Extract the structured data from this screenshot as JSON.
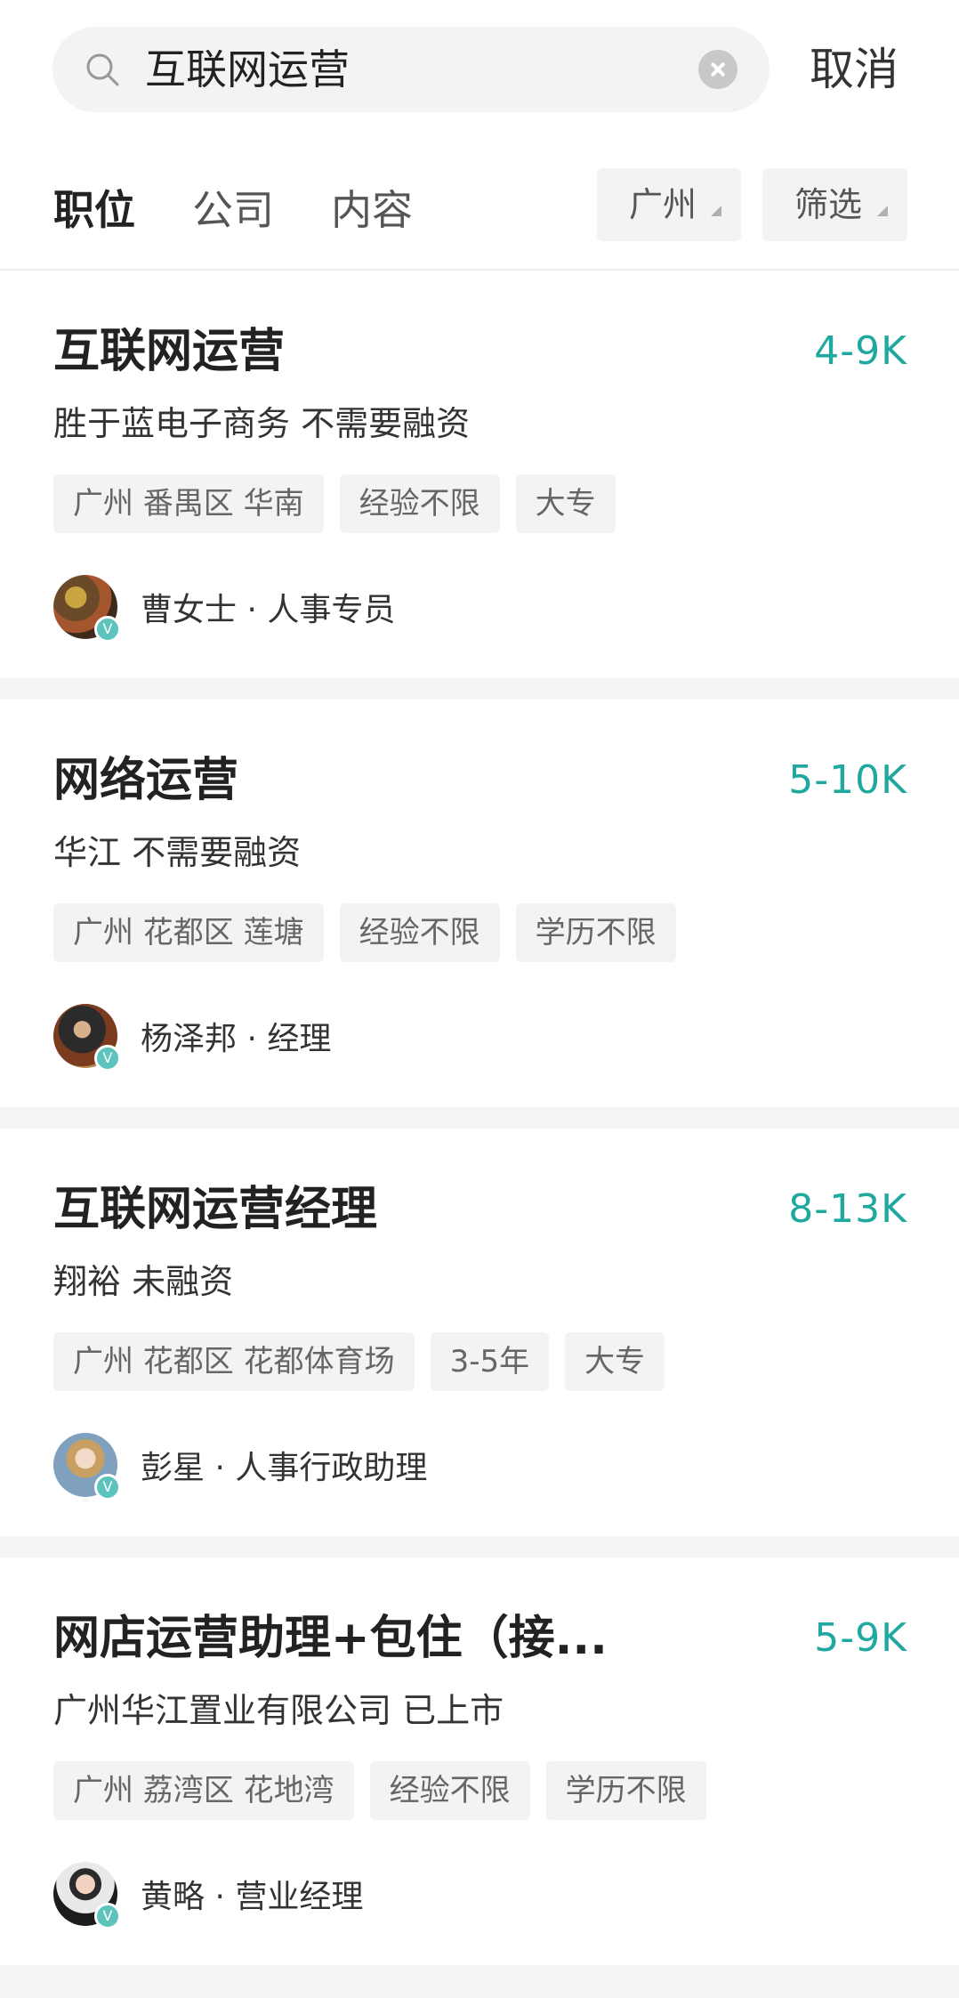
{
  "search": {
    "query": "互联网运营",
    "cancel_label": "取消"
  },
  "tabs": [
    {
      "label": "职位",
      "active": true
    },
    {
      "label": "公司",
      "active": false
    },
    {
      "label": "内容",
      "active": false
    }
  ],
  "filters": {
    "city_label": "广州",
    "more_label": "筛选"
  },
  "colors": {
    "salary": "#1fa8a0",
    "badge": "#5cc4bd"
  },
  "jobs": [
    {
      "title": "互联网运营",
      "salary": "4-9K",
      "company": "胜于蓝电子商务  不需要融资",
      "tags": [
        "广州 番禺区 华南",
        "经验不限",
        "大专"
      ],
      "recruiter": "曹女士 · 人事专员",
      "badge": "V"
    },
    {
      "title": "网络运营",
      "salary": "5-10K",
      "company": "华江  不需要融资",
      "tags": [
        "广州 花都区 莲塘",
        "经验不限",
        "学历不限"
      ],
      "recruiter": "杨泽邦 · 经理",
      "badge": "V"
    },
    {
      "title": "互联网运营经理",
      "salary": "8-13K",
      "company": "翔裕  未融资",
      "tags": [
        "广州 花都区 花都体育场",
        "3-5年",
        "大专"
      ],
      "recruiter": "彭星 · 人事行政助理",
      "badge": "V"
    },
    {
      "title": "网店运营助理+包住（接...",
      "salary": "5-9K",
      "company": "广州华江置业有限公司  已上市",
      "tags": [
        "广州 荔湾区 花地湾",
        "经验不限",
        "学历不限"
      ],
      "recruiter": "黄略 · 营业经理",
      "badge": "V"
    }
  ]
}
